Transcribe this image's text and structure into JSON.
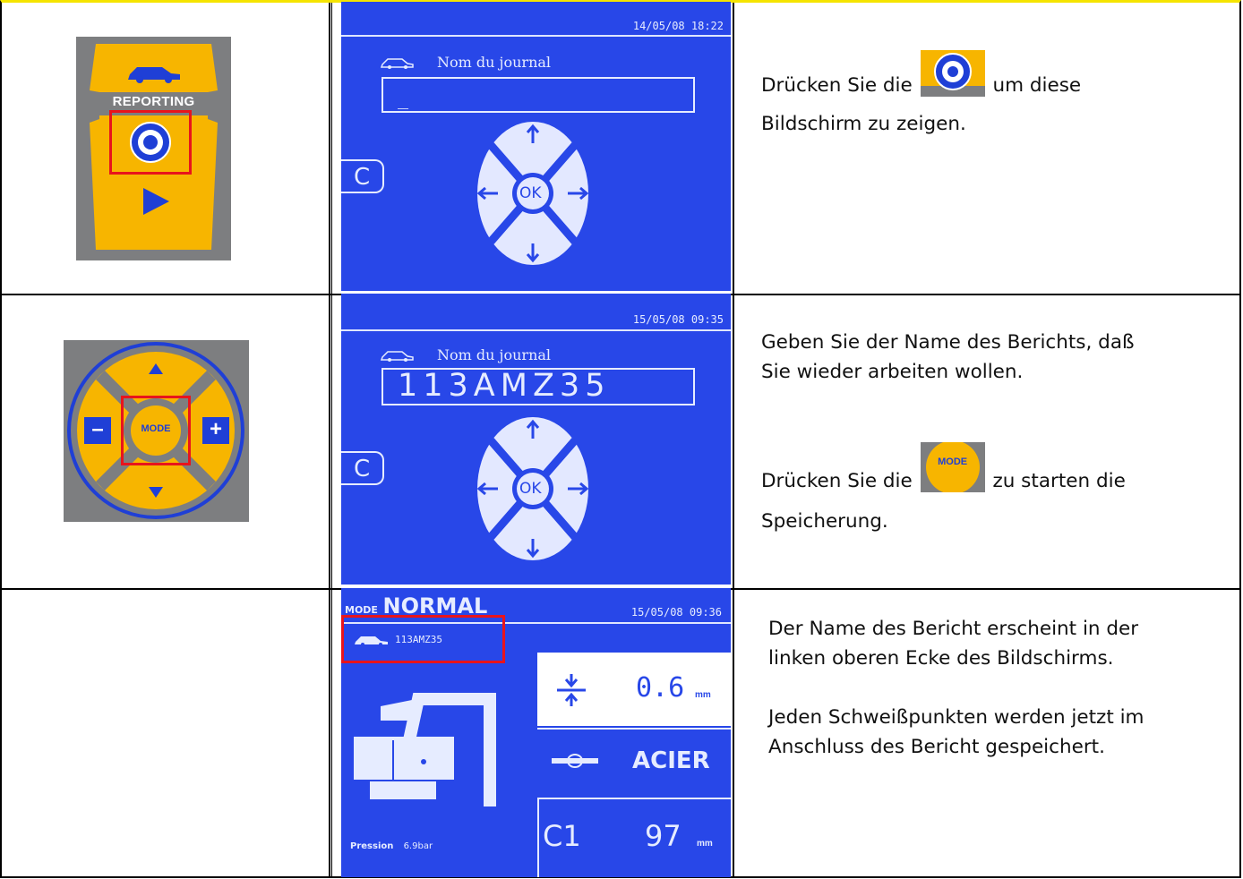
{
  "rows": [
    {
      "panel": {
        "top_label": "REPORTING"
      },
      "screen": {
        "datetime": "14/05/08 18:22",
        "field_label": "Nom du journal",
        "field_value": "_",
        "back_key": "C",
        "ok_key": "OK"
      },
      "text": {
        "before_icon": "Drücken Sie die",
        "after_icon": "um diese",
        "line2": "Bildschirm zu zeigen."
      }
    },
    {
      "panel": {
        "center_key": "MODE"
      },
      "screen": {
        "datetime": "15/05/08 09:35",
        "field_label": "Nom du journal",
        "field_value": "113AMZ35",
        "back_key": "C",
        "ok_key": "OK"
      },
      "text": {
        "para1_line1": "Geben Sie der Name des Berichts, daß",
        "para1_line2": "Sie wieder arbeiten wollen.",
        "before_icon": "Drücken Sie die",
        "icon_label": "MODE",
        "after_icon": "zu starten die",
        "line_last": "Speicherung."
      }
    },
    {
      "screen": {
        "mode_prefix": "MODE",
        "mode_value": "NORMAL",
        "datetime": "15/05/08 09:36",
        "report_name": "113AMZ35",
        "thickness_value": "0.6",
        "thickness_unit": "mm",
        "material": "ACIER",
        "arm_code": "C1",
        "arm_value": "97",
        "arm_unit": "mm",
        "pressure_label": "Pression",
        "pressure_value": "6.9bar"
      },
      "text": {
        "line1": "Der Name des Bericht erscheint in der",
        "line2": "linken oberen Ecke des Bildschirms.",
        "line3": "Jeden Schweißpunkten werden jetzt im",
        "line4": "Anschluss des Bericht gespeichert."
      }
    }
  ],
  "colors": {
    "screen_blue": "#2847e8",
    "panel_gray": "#7d7e80",
    "amber": "#f7b500",
    "button_blue": "#1f3fd6",
    "highlight_red": "#e8141c"
  }
}
